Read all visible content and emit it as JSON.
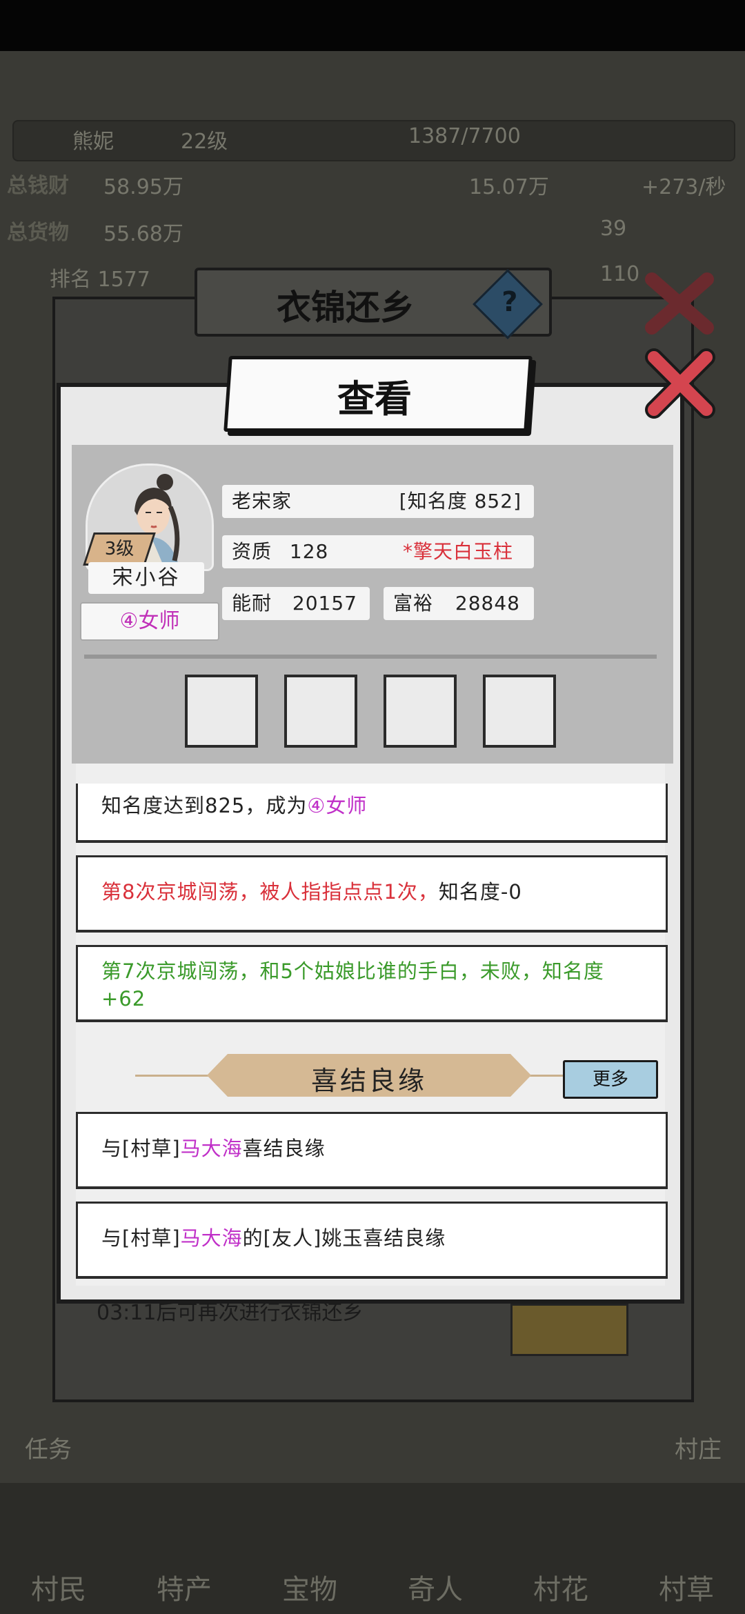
{
  "background": {
    "player_name": "熊妮",
    "player_level": "22级",
    "exp_progress": "1387/7700",
    "total_wealth_label": "总钱财",
    "total_wealth_value": "58.95万",
    "total_goods_label": "总货物",
    "total_goods_value": "55.68万",
    "coins_value": "15.07万",
    "coins_rate": "+273/秒",
    "rank_text": "排名 1577",
    "stat_a": "39",
    "stat_b": "110",
    "task_label": "任务",
    "village_label": "村庄",
    "nav": [
      "村民",
      "特产",
      "宝物",
      "奇人",
      "村花",
      "村草"
    ]
  },
  "outer_dialog": {
    "title": "衣锦还乡",
    "help_icon": "?",
    "footer_text": "03:11后可再次进行衣锦还乡"
  },
  "dialog": {
    "title": "查看",
    "profile": {
      "level": "3级",
      "name": "宋小谷",
      "rank_title": "④女师",
      "family": "老宋家",
      "fame": "[知名度 852]",
      "aptitude_label": "资质",
      "aptitude_value": "128",
      "trait": "*擎天白玉柱",
      "ability_label": "能耐",
      "ability_value": "20157",
      "wealth_label": "富裕",
      "wealth_value": "28848"
    },
    "logs": [
      {
        "part1": "知名度达到825，成为",
        "part2": "④女师"
      },
      {
        "part1": "第8次京城闯荡，被人指指点点1次，",
        "part2": "知名度-0"
      },
      {
        "text": "第7次京城闯荡，和5个姑娘比谁的手白，未败，知名度+62"
      }
    ],
    "marriage_section": {
      "title": "喜结良缘",
      "more_label": "更多",
      "entries": [
        {
          "prefix": "与[村草]",
          "name": "马大海",
          "suffix": "喜结良缘"
        },
        {
          "prefix": "与[村草]",
          "name": "马大海",
          "suffix": "的[友人]姚玉喜结良缘"
        }
      ]
    }
  },
  "colors": {
    "highlight_purple": "#c030c8",
    "highlight_red": "#d9303a",
    "highlight_green": "#3a9a2a",
    "banner_tan": "#d5b994",
    "more_button_blue": "#a8cde0",
    "close_red": "#d4454f"
  }
}
